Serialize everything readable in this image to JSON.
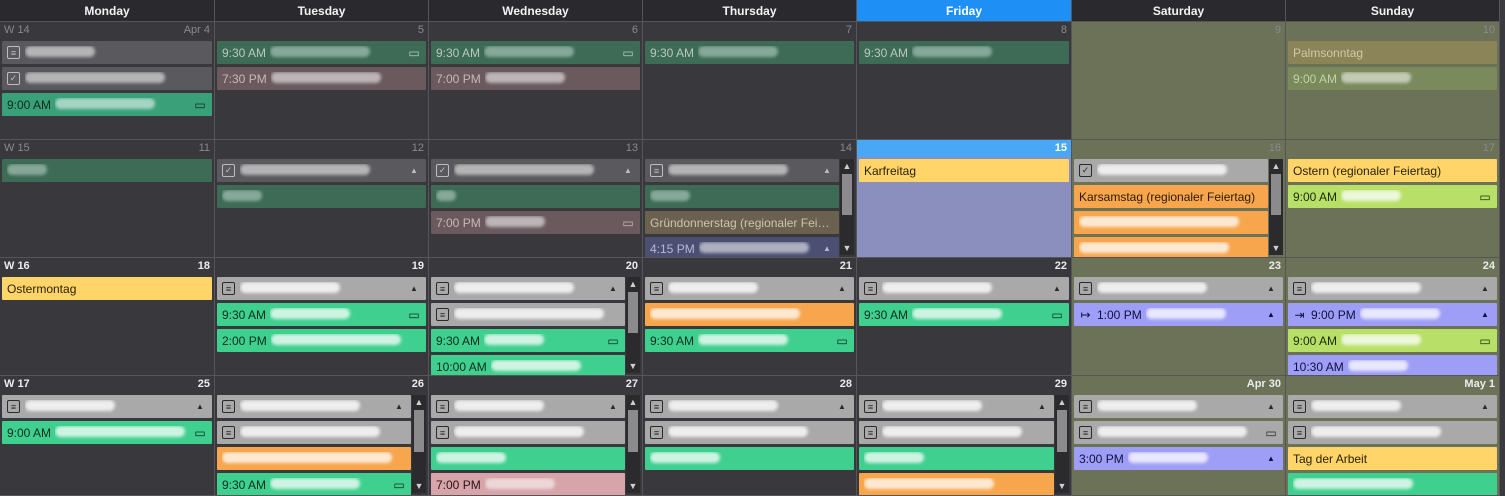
{
  "days": [
    "Monday",
    "Tuesday",
    "Wednesday",
    "Thursday",
    "Friday",
    "Saturday",
    "Sunday"
  ],
  "today_index": 4,
  "weeks": [
    {
      "cells": [
        {
          "week": "W 14",
          "num": "Apr 4",
          "weekend": false,
          "events": [
            {
              "kind": "gray",
              "lead": "square",
              "blur": 70
            },
            {
              "kind": "gray",
              "lead": "check",
              "blur": 140
            },
            {
              "kind": "teal",
              "time": "9:00 AM",
              "blur": 100,
              "icon": "chat"
            }
          ]
        },
        {
          "num": "5",
          "events": [
            {
              "kind": "green",
              "time": "9:30 AM",
              "blur": 100,
              "icon": "chat"
            },
            {
              "kind": "rose",
              "time": "7:30 PM",
              "blur": 110
            }
          ]
        },
        {
          "num": "6",
          "events": [
            {
              "kind": "green",
              "time": "9:30 AM",
              "blur": 90,
              "icon": "chat"
            },
            {
              "kind": "rose",
              "time": "7:00 PM",
              "blur": 80
            }
          ]
        },
        {
          "num": "7",
          "events": [
            {
              "kind": "green",
              "time": "9:30 AM",
              "blur": 80
            }
          ]
        },
        {
          "num": "8",
          "events": [
            {
              "kind": "green",
              "time": "9:30 AM",
              "blur": 80
            }
          ]
        },
        {
          "num": "9",
          "weekend": true,
          "events": []
        },
        {
          "num": "10",
          "weekend": true,
          "events": [
            {
              "kind": "olive",
              "text": "Palmsonntag"
            },
            {
              "kind": "olivegreen",
              "time": "9:00 AM",
              "blur": 70
            }
          ]
        }
      ]
    },
    {
      "cells": [
        {
          "week": "W 15",
          "num": "11",
          "events": [
            {
              "kind": "green",
              "blur": 40,
              "lead_none": true
            }
          ]
        },
        {
          "num": "12",
          "events": [
            {
              "kind": "gray",
              "lead": "check",
              "blur": 130,
              "icon": "bell"
            },
            {
              "kind": "green",
              "blur": 40
            }
          ]
        },
        {
          "num": "13",
          "events": [
            {
              "kind": "gray",
              "lead": "check",
              "blur": 140,
              "icon": "bell"
            },
            {
              "kind": "green",
              "blur": 20
            },
            {
              "kind": "rose",
              "time": "7:00 PM",
              "blur": 60,
              "icon": "chat"
            }
          ]
        },
        {
          "num": "14",
          "scroll": true,
          "events": [
            {
              "kind": "gray",
              "lead": "square",
              "blur": 120,
              "icon": "bell"
            },
            {
              "kind": "green",
              "blur": 40
            },
            {
              "kind": "brownish",
              "text": "Gründonnerstag (regionaler Feie..."
            },
            {
              "kind": "navy",
              "time": "4:15 PM",
              "blur": 110,
              "icon": "bell"
            }
          ]
        },
        {
          "num": "15",
          "today": true,
          "events": [
            {
              "kind": "yellow",
              "text": "Karfreitag"
            }
          ]
        },
        {
          "num": "16",
          "weekend": true,
          "scroll": true,
          "events": [
            {
              "kind": "gray2",
              "lead": "check",
              "blur": 130
            },
            {
              "kind": "orange",
              "text": "Karsamstag (regionaler Feiertag)"
            },
            {
              "kind": "orange",
              "blur": 160
            },
            {
              "kind": "orange",
              "blur": 150
            }
          ]
        },
        {
          "num": "17",
          "weekend": true,
          "events": [
            {
              "kind": "yellow",
              "text": "Ostern (regionaler Feiertag)"
            },
            {
              "kind": "lime",
              "time": "9:00 AM",
              "blur": 60,
              "icon": "chat"
            }
          ]
        }
      ]
    },
    {
      "cells": [
        {
          "week": "W 16",
          "num": "18",
          "bright": true,
          "events": [
            {
              "kind": "yellow",
              "text": "Ostermontag"
            }
          ]
        },
        {
          "num": "19",
          "bright": true,
          "events": [
            {
              "kind": "gray2",
              "lead": "square",
              "blur": 100,
              "icon": "bell"
            },
            {
              "kind": "mint",
              "time": "9:30 AM",
              "blur": 80,
              "icon": "chat"
            },
            {
              "kind": "mint",
              "time": "2:00 PM",
              "blur": 130
            }
          ]
        },
        {
          "num": "20",
          "bright": true,
          "scroll": true,
          "events": [
            {
              "kind": "gray2",
              "lead": "square",
              "blur": 120,
              "icon": "bell"
            },
            {
              "kind": "gray2",
              "lead": "square",
              "blur": 150
            },
            {
              "kind": "mint",
              "time": "9:30 AM",
              "blur": 60,
              "icon": "chat"
            },
            {
              "kind": "mint",
              "time": "10:00 AM",
              "blur": 90
            }
          ]
        },
        {
          "num": "21",
          "bright": true,
          "events": [
            {
              "kind": "gray2",
              "lead": "square",
              "blur": 90,
              "icon": "bell"
            },
            {
              "kind": "orange",
              "blur": 150
            },
            {
              "kind": "mint",
              "time": "9:30 AM",
              "blur": 90,
              "icon": "chat"
            }
          ]
        },
        {
          "num": "22",
          "bright": true,
          "events": [
            {
              "kind": "gray2",
              "lead": "square",
              "blur": 110,
              "icon": "bell"
            },
            {
              "kind": "mint",
              "time": "9:30 AM",
              "blur": 90,
              "icon": "chat"
            }
          ]
        },
        {
          "num": "23",
          "weekend": true,
          "bright": true,
          "events": [
            {
              "kind": "gray2",
              "lead": "square",
              "blur": 110,
              "icon": "bell"
            },
            {
              "kind": "purple",
              "lead": "arrow",
              "time": "1:00 PM",
              "blur": 80,
              "icon": "bell"
            }
          ]
        },
        {
          "num": "24",
          "weekend": true,
          "bright": true,
          "events": [
            {
              "kind": "gray2",
              "lead": "square",
              "blur": 110,
              "icon": "bell"
            },
            {
              "kind": "purple",
              "lead": "arrowin",
              "time": "9:00 PM",
              "blur": 80,
              "icon": "bell"
            },
            {
              "kind": "lime",
              "time": "9:00 AM",
              "blur": 80,
              "icon": "chat"
            },
            {
              "kind": "purple",
              "time": "10:30 AM",
              "blur": 60
            }
          ]
        }
      ]
    },
    {
      "cells": [
        {
          "week": "W 17",
          "num": "25",
          "bright": true,
          "events": [
            {
              "kind": "gray2",
              "lead": "square",
              "blur": 90,
              "icon": "bell"
            },
            {
              "kind": "mint",
              "time": "9:00 AM",
              "blur": 130,
              "icon": "chat"
            }
          ]
        },
        {
          "num": "26",
          "bright": true,
          "scroll": true,
          "events": [
            {
              "kind": "gray2",
              "lead": "square",
              "blur": 120,
              "icon": "bell"
            },
            {
              "kind": "gray2",
              "lead": "square",
              "blur": 140
            },
            {
              "kind": "orange",
              "blur": 170
            },
            {
              "kind": "mint",
              "time": "9:30 AM",
              "blur": 90,
              "icon": "chat"
            }
          ]
        },
        {
          "num": "27",
          "bright": true,
          "scroll": true,
          "events": [
            {
              "kind": "gray2",
              "lead": "square",
              "blur": 90,
              "icon": "bell"
            },
            {
              "kind": "gray2",
              "lead": "square",
              "blur": 130
            },
            {
              "kind": "mint",
              "blur": 70
            },
            {
              "kind": "pink",
              "time": "7:00 PM",
              "blur": 70
            }
          ]
        },
        {
          "num": "28",
          "bright": true,
          "events": [
            {
              "kind": "gray2",
              "lead": "square",
              "blur": 110,
              "icon": "bell"
            },
            {
              "kind": "gray2",
              "lead": "square",
              "blur": 140
            },
            {
              "kind": "mint",
              "blur": 70
            }
          ]
        },
        {
          "num": "29",
          "bright": true,
          "scroll": true,
          "events": [
            {
              "kind": "gray2",
              "lead": "square",
              "blur": 100,
              "icon": "bell"
            },
            {
              "kind": "gray2",
              "lead": "square",
              "blur": 140
            },
            {
              "kind": "mint",
              "blur": 60
            },
            {
              "kind": "orange",
              "blur": 130
            }
          ]
        },
        {
          "num": "Apr 30",
          "weekend": true,
          "bright": true,
          "events": [
            {
              "kind": "gray2",
              "lead": "square",
              "blur": 100,
              "icon": "bell"
            },
            {
              "kind": "gray2",
              "lead": "square",
              "blur": 150,
              "icon": "chat"
            },
            {
              "kind": "purple",
              "time": "3:00 PM",
              "blur": 80,
              "icon": "bell"
            }
          ]
        },
        {
          "num": "May 1",
          "weekend": true,
          "bright": true,
          "events": [
            {
              "kind": "gray2",
              "lead": "square",
              "blur": 90,
              "icon": "bell"
            },
            {
              "kind": "gray2",
              "lead": "square",
              "blur": 130
            },
            {
              "kind": "yellow",
              "text": "Tag der Arbeit"
            },
            {
              "kind": "mint",
              "blur": 120
            }
          ]
        }
      ]
    }
  ],
  "icons": {
    "chat": "chat-bubble-icon",
    "bell": "bell-icon",
    "square": "note-icon",
    "check": "checkbox-icon",
    "arrow": "arrow-right-icon",
    "arrowin": "arrow-into-icon",
    "scroll_up": "scroll-up-icon",
    "scroll_down": "scroll-down-icon"
  },
  "colors": {
    "today_header": "#1e8ff5",
    "today_cell": "#8a8fbe",
    "weekend_cell": "#6c7257",
    "mint": "#3fd08f",
    "orange": "#f7a64d",
    "yellow": "#ffd468",
    "lime": "#b8e068",
    "purple": "#9e9ef7"
  }
}
